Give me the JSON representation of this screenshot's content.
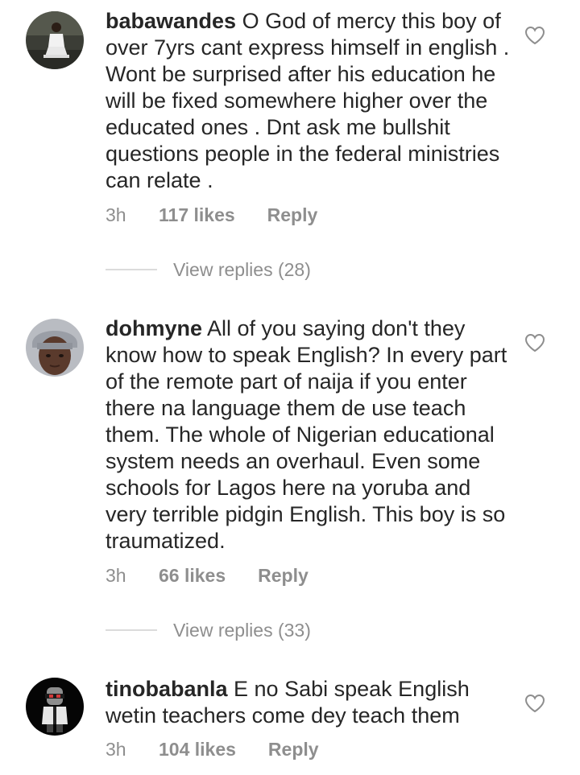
{
  "comments": [
    {
      "username": "babawandes",
      "text": "O God of mercy this boy of over 7yrs cant express himself in english . Wont be surprised after his education he will be fixed somewhere higher over the educated ones . Dnt ask me bullshit questions people in the federal ministries can relate .",
      "time": "3h",
      "likes": "117 likes",
      "reply": "Reply",
      "view_replies": "View replies (28)",
      "avatar_icon": "profile-photo-man-white-outfit",
      "like_icon": "heart-outline-icon"
    },
    {
      "username": "dohmyne",
      "text": "All of you saying don't they know how to speak English? In every part of the remote part of naija if you enter there na language them de use teach them. The whole of Nigerian educational system needs an overhaul. Even some schools for Lagos here na yoruba and very terrible pidgin English. This boy is so traumatized.",
      "time": "3h",
      "likes": "66 likes",
      "reply": "Reply",
      "view_replies": "View replies (33)",
      "avatar_icon": "profile-photo-woman-beanie",
      "like_icon": "heart-outline-icon"
    },
    {
      "username": "tinobabanla",
      "text": "E no Sabi speak English wetin teachers come dey teach them",
      "time": "3h",
      "likes": "104 likes",
      "reply": "Reply",
      "avatar_icon": "profile-photo-cartoon-character",
      "like_icon": "heart-outline-icon"
    }
  ],
  "colors": {
    "text": "#262626",
    "meta": "#8e8e8e",
    "divider": "#dbdbdb"
  }
}
